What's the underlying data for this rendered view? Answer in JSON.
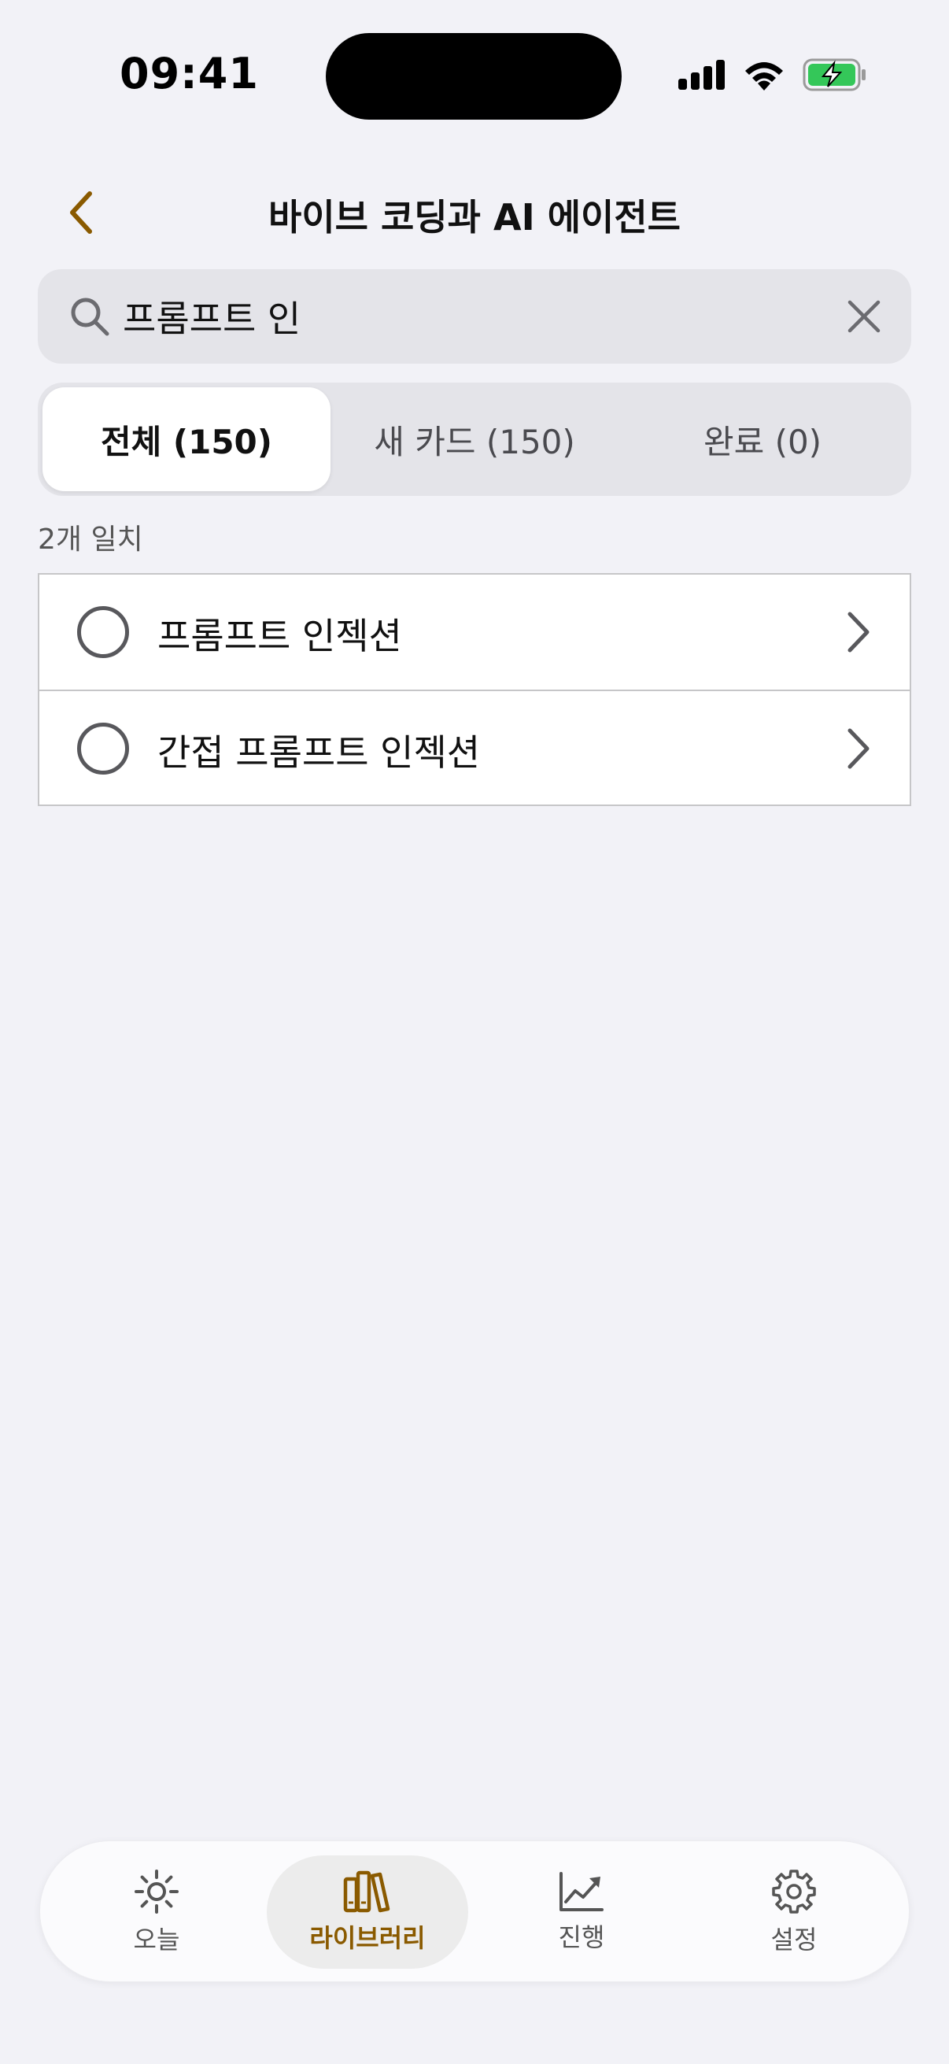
{
  "status_bar": {
    "time": "09:41",
    "icons": [
      "cellular-signal-icon",
      "wifi-icon",
      "battery-charging-icon"
    ]
  },
  "header": {
    "title": "바이브 코딩과 AI 에이전트",
    "back_icon": "chevron-left-icon"
  },
  "search": {
    "value": "프롬프트 인",
    "placeholder": "",
    "icon": "search-icon",
    "clear_icon": "close-icon"
  },
  "segments": [
    {
      "label": "전체 (150)",
      "selected": true
    },
    {
      "label": "새 카드 (150)",
      "selected": false
    },
    {
      "label": "완료 (0)",
      "selected": false
    }
  ],
  "results": {
    "count_label": "2개 일치",
    "items": [
      {
        "label": "프롬프트 인젝션"
      },
      {
        "label": "간접 프롬프트 인젝션"
      }
    ]
  },
  "tabbar": {
    "tabs": [
      {
        "label": "오늘",
        "icon": "sun-icon"
      },
      {
        "label": "라이브러리",
        "icon": "books-icon",
        "active": true
      },
      {
        "label": "진행",
        "icon": "chart-icon"
      },
      {
        "label": "설정",
        "icon": "gear-icon"
      }
    ]
  },
  "colors": {
    "accent": "#8A5A00",
    "background": "#F2F2F7",
    "battery_green": "#34C759"
  }
}
